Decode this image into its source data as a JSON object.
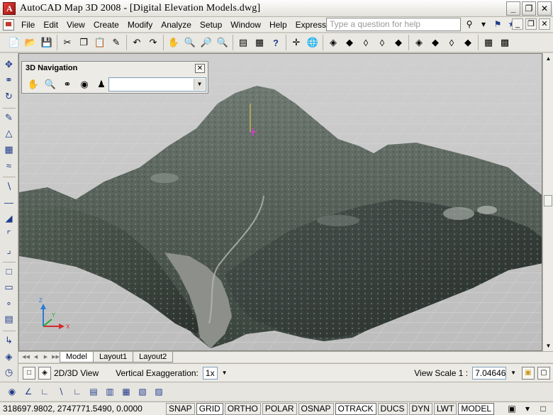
{
  "window": {
    "title": "AutoCAD Map 3D 2008 - [Digital Elevation Models.dwg]",
    "controls": [
      "_",
      "❐",
      "✕"
    ]
  },
  "menu": {
    "items": [
      "File",
      "Edit",
      "View",
      "Create",
      "Modify",
      "Analyze",
      "Setup",
      "Window",
      "Help",
      "Express"
    ],
    "help_placeholder": "Type a question for help"
  },
  "nav_panel": {
    "title": "3D Navigation",
    "close": "✕"
  },
  "layout_tabs": [
    "Model",
    "Layout1",
    "Layout2"
  ],
  "view_bar": {
    "view_mode": "2D/3D View",
    "vertical_exaggeration_label": "Vertical Exaggeration:",
    "vertical_exaggeration_value": "1x",
    "view_scale_label": "View Scale 1 :",
    "view_scale_value": "7.04646"
  },
  "status": {
    "coordinates": "318697.9802, 2747771.5490, 0.0000",
    "toggles": [
      {
        "label": "SNAP",
        "on": false
      },
      {
        "label": "GRID",
        "on": true
      },
      {
        "label": "ORTHO",
        "on": false
      },
      {
        "label": "POLAR",
        "on": false
      },
      {
        "label": "OSNAP",
        "on": false
      },
      {
        "label": "OTRACK",
        "on": true
      },
      {
        "label": "DUCS",
        "on": false
      },
      {
        "label": "DYN",
        "on": false
      },
      {
        "label": "LWT",
        "on": false
      },
      {
        "label": "MODEL",
        "on": true
      }
    ]
  },
  "ucs": {
    "x": "X",
    "y": "Y",
    "z": "Z"
  },
  "colors": {
    "viewport_bg": "#c6c6c6",
    "terrain_dark": "#3b4640",
    "river": "#8f8f8a"
  }
}
